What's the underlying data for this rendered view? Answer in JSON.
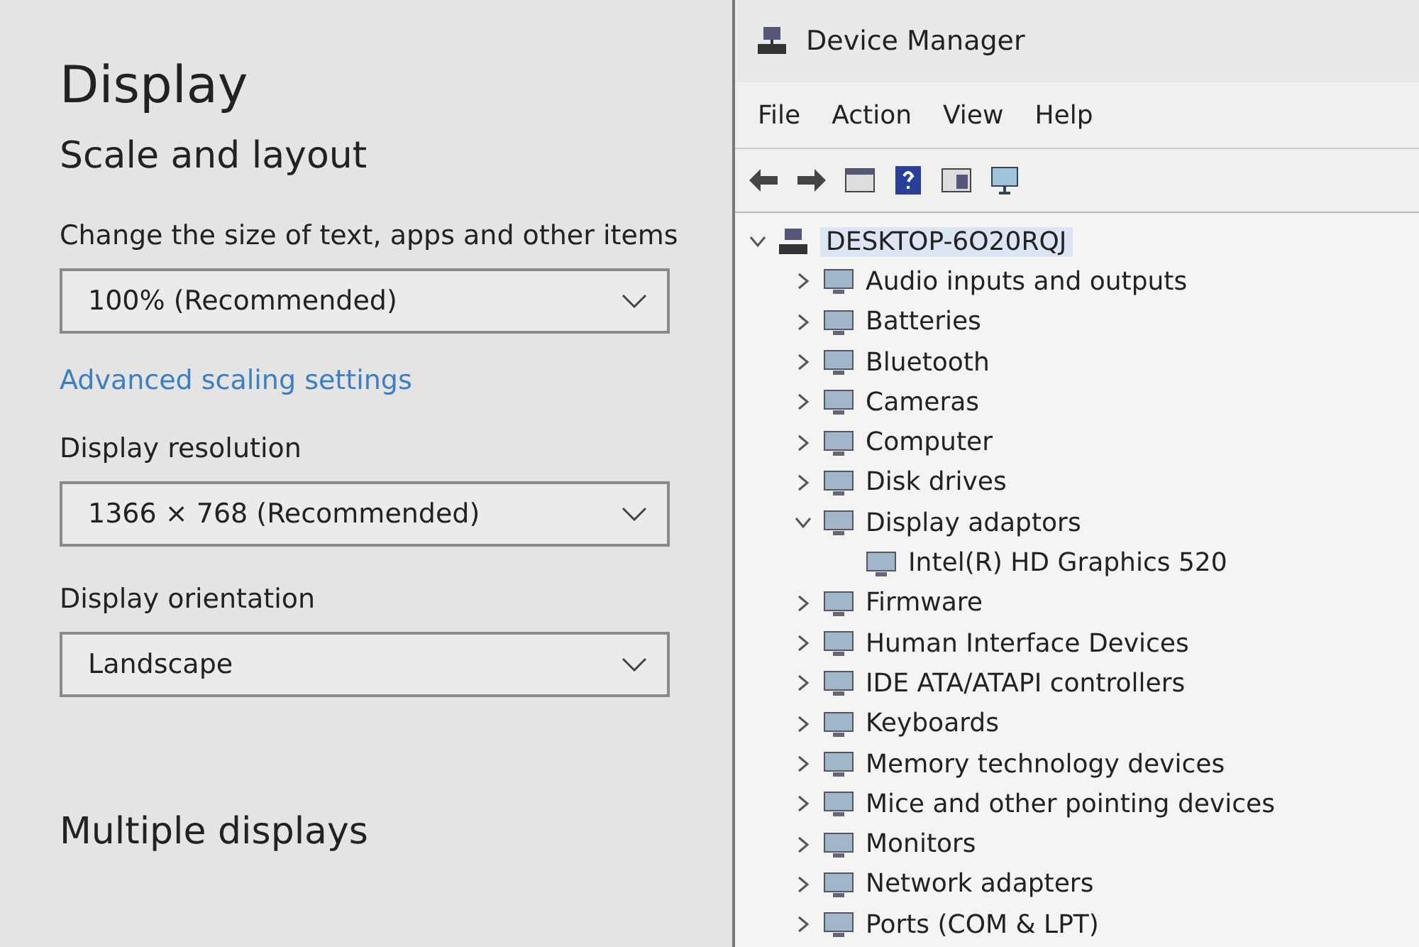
{
  "settings": {
    "title": "Display",
    "section": "Scale and layout",
    "items": [
      {
        "kind": "dropdown",
        "label": "Change the size of text, apps and other items",
        "value": "100% (Recommended)"
      },
      {
        "kind": "link",
        "text": "Advanced scaling settings"
      },
      {
        "kind": "dropdown",
        "label": "Display resolution",
        "value": "1366 × 768 (Recommended)"
      },
      {
        "kind": "dropdown",
        "label": "Display orientation",
        "value": "Landscape"
      }
    ],
    "next_section": "Multiple displays"
  },
  "device_manager": {
    "title": "Device Manager",
    "menu": [
      "File",
      "Action",
      "View",
      "Help"
    ],
    "tree": {
      "label": "DESKTOP-6O20RQJ",
      "expanded": true,
      "selected": true,
      "children": [
        {
          "label": "Audio inputs and outputs",
          "expanded": false
        },
        {
          "label": "Batteries",
          "expanded": false
        },
        {
          "label": "Bluetooth",
          "expanded": false
        },
        {
          "label": "Cameras",
          "expanded": false
        },
        {
          "label": "Computer",
          "expanded": false
        },
        {
          "label": "Disk drives",
          "expanded": false
        },
        {
          "label": "Display adaptors",
          "expanded": true,
          "children": [
            {
              "label": "Intel(R) HD Graphics 520"
            }
          ]
        },
        {
          "label": "Firmware",
          "expanded": false
        },
        {
          "label": "Human Interface Devices",
          "expanded": false
        },
        {
          "label": "IDE ATA/ATAPI controllers",
          "expanded": false
        },
        {
          "label": "Keyboards",
          "expanded": false
        },
        {
          "label": "Memory technology devices",
          "expanded": false
        },
        {
          "label": "Mice and other pointing devices",
          "expanded": false
        },
        {
          "label": "Monitors",
          "expanded": false
        },
        {
          "label": "Network adapters",
          "expanded": false
        },
        {
          "label": "Ports (COM & LPT)",
          "expanded": false
        }
      ]
    }
  }
}
